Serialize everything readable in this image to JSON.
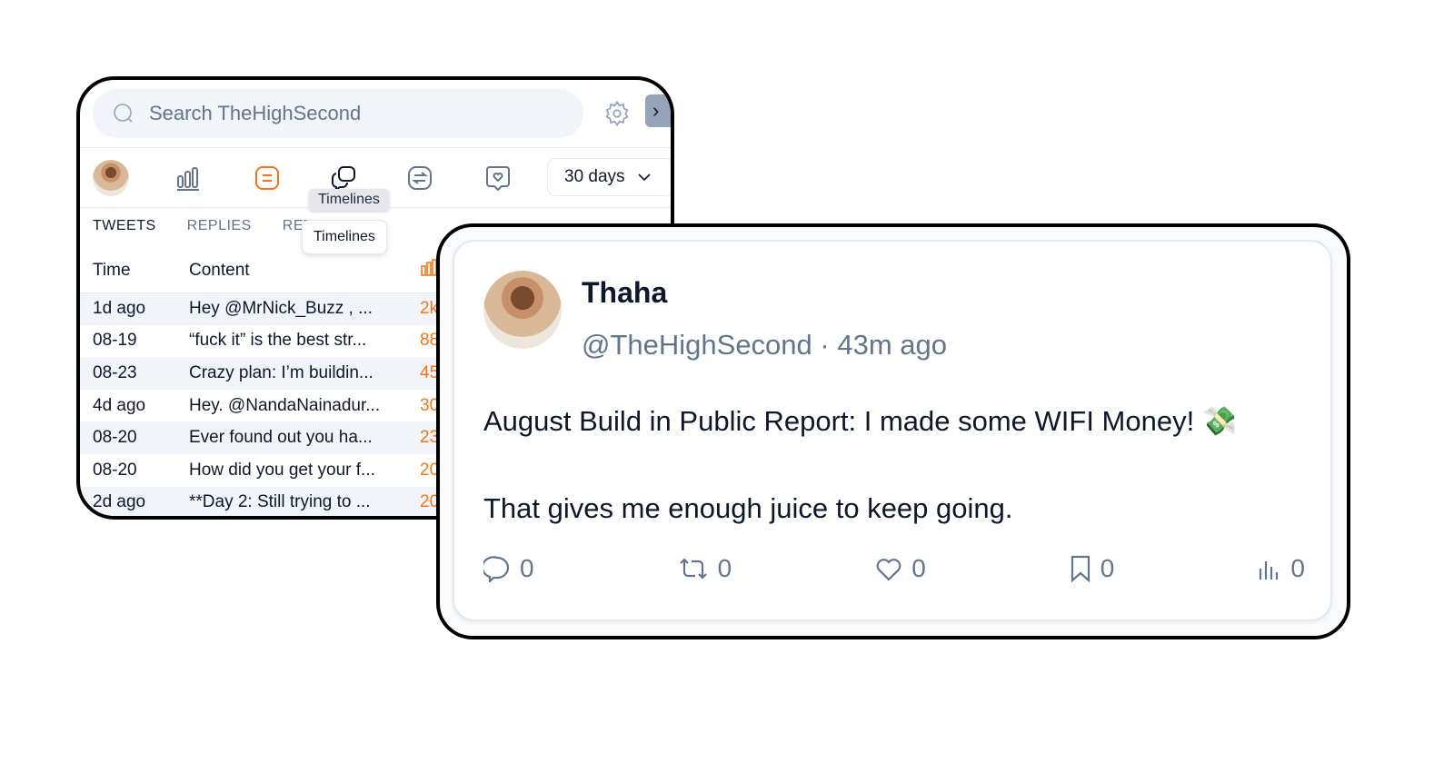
{
  "search": {
    "placeholder": "Search TheHighSecond"
  },
  "toolbar": {
    "icons": [
      "avatar",
      "bar-chart-icon",
      "list-icon",
      "chat-bubbles-icon",
      "swap-icon",
      "heart-bubble-icon"
    ],
    "active_color": "#f97316",
    "tooltip": "Timelines",
    "tooltip_popover": "Timelines",
    "range_select": "30 days"
  },
  "tabs": [
    {
      "label": "TWEETS",
      "active": true
    },
    {
      "label": "REPLIES",
      "active": false
    },
    {
      "label": "RET",
      "active": false
    }
  ],
  "table": {
    "headers": {
      "time": "Time",
      "content": "Content"
    },
    "rows": [
      {
        "time": "1d ago",
        "content": "Hey @MrNick_Buzz , ...",
        "value": "2k"
      },
      {
        "time": "08-19",
        "content": "“fuck it” is the best str...",
        "value": "88"
      },
      {
        "time": "08-23",
        "content": "Crazy plan: I’m buildin...",
        "value": "45"
      },
      {
        "time": "4d ago",
        "content": "Hey. @NandaNainadur...",
        "value": "30"
      },
      {
        "time": "08-20",
        "content": "Ever found out you ha...",
        "value": "23"
      },
      {
        "time": "08-20",
        "content": "How did you get your f...",
        "value": "20"
      },
      {
        "time": "2d ago",
        "content": "**Day 2: Still trying to ...",
        "value": "20"
      }
    ]
  },
  "tweet": {
    "name": "Thaha",
    "handle": "@TheHighSecond · 43m ago",
    "line1": "August Build in Public Report: I made some WIFI Money! 💸",
    "line2": "That gives me enough juice to keep going.",
    "stats": {
      "replies": "0",
      "retweets": "0",
      "likes": "0",
      "bookmarks": "0",
      "views": "0"
    }
  }
}
